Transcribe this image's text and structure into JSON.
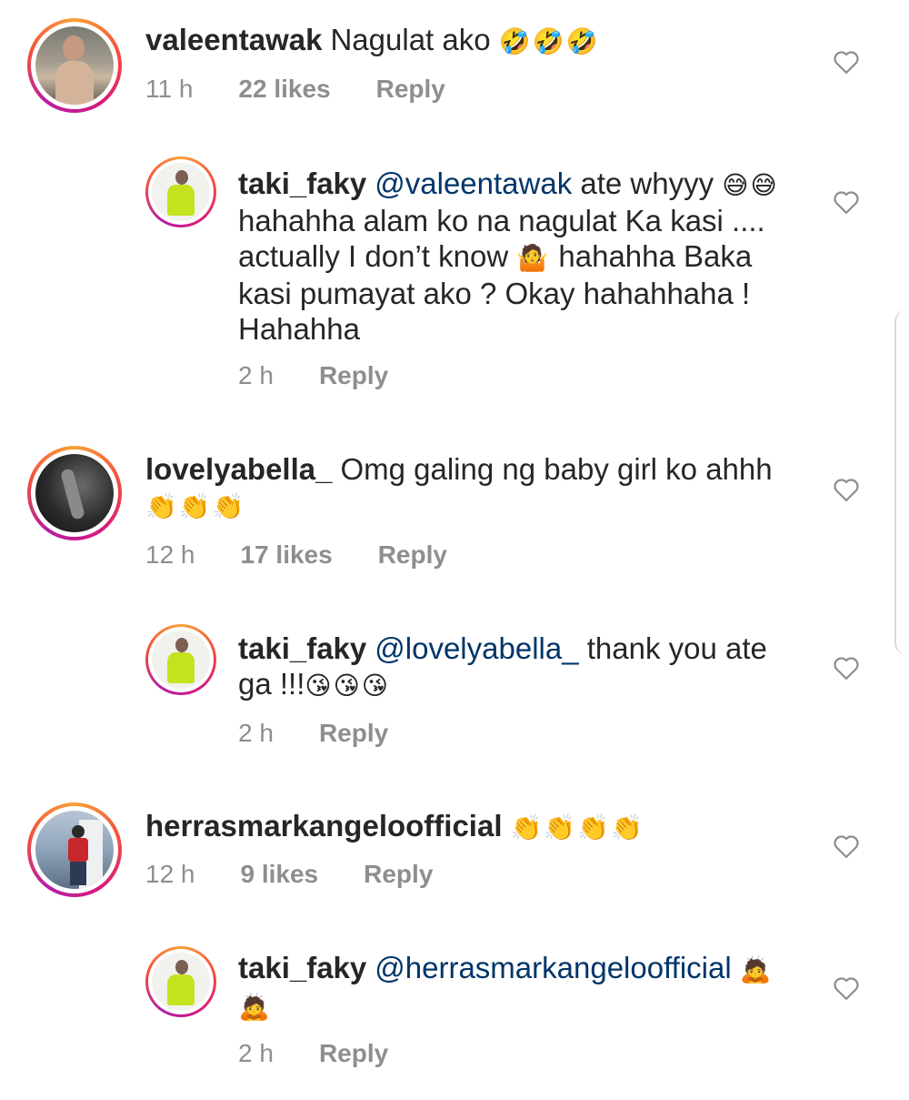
{
  "comments": [
    {
      "username": "valeentawak",
      "mention": "",
      "text": "Nagulat ako",
      "emoji": "🤣🤣🤣",
      "emoji_trailing": "",
      "time": "11 h",
      "likes": "22 likes",
      "reply": "Reply",
      "avatar_icon": "woman-avatar",
      "heart_icon": "heart-outline-icon"
    },
    {
      "username": "taki_faky",
      "mention": "@valeentawak",
      "text": "ate whyyy",
      "emoji": "😅😅",
      "text2": "hahahha alam ko na nagulat Ka kasi .... actually I don’t know",
      "emoji2": "🤷",
      "text3": "hahahha Baka kasi pumayat ako ? Okay hahahhaha ! Hahahha",
      "time": "2 h",
      "likes": "",
      "reply": "Reply",
      "avatar_icon": "woman-green-top-avatar",
      "heart_icon": "heart-outline-icon"
    },
    {
      "username": "lovelyabella_",
      "mention": "",
      "text": "Omg galing ng baby girl ko ahhh",
      "emoji": "👏👏👏",
      "time": "12 h",
      "likes": "17 likes",
      "reply": "Reply",
      "avatar_icon": "dark-photo-avatar",
      "heart_icon": "heart-outline-icon"
    },
    {
      "username": "taki_faky",
      "mention": "@lovelyabella_",
      "text": "thank you ate ga !!!",
      "emoji": "😘😘😘",
      "time": "2 h",
      "likes": "",
      "reply": "Reply",
      "avatar_icon": "woman-green-top-avatar",
      "heart_icon": "heart-outline-icon"
    },
    {
      "username": "herrasmarkangeloofficial",
      "mention": "",
      "text": "",
      "emoji": "👏👏👏👏",
      "time": "12 h",
      "likes": "9 likes",
      "reply": "Reply",
      "avatar_icon": "man-outdoor-avatar",
      "heart_icon": "heart-outline-icon"
    },
    {
      "username": "taki_faky",
      "mention": "@herrasmarkangeloofficial",
      "text": "",
      "emoji": "🙇",
      "emoji_line2": "🙇",
      "time": "2 h",
      "likes": "",
      "reply": "Reply",
      "avatar_icon": "woman-green-top-avatar",
      "heart_icon": "heart-outline-icon"
    }
  ],
  "colors": {
    "username": "#262626",
    "mention": "#003569",
    "meta": "#8e8e8e",
    "ring_start": "#f9a13a",
    "ring_end": "#b41ea4"
  }
}
